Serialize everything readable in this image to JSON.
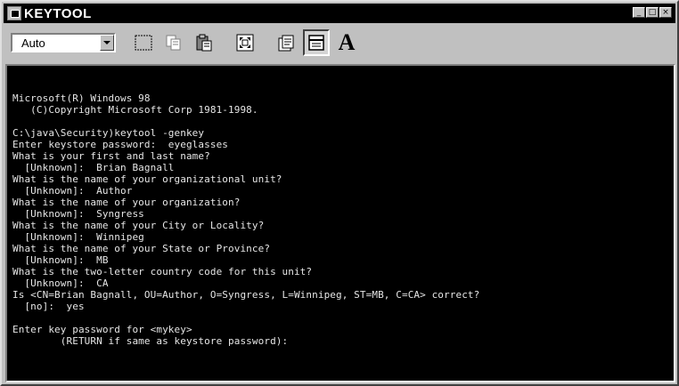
{
  "window": {
    "title": "KEYTOOL",
    "minimize_glyph": "_",
    "maximize_glyph": "□",
    "close_glyph": "×"
  },
  "toolbar": {
    "font_size_value": "Auto",
    "icons": [
      "mark-icon",
      "copy-icon",
      "paste-icon",
      "full-screen-icon",
      "properties-icon",
      "background-icon",
      "font-icon"
    ],
    "font_button_label": "A"
  },
  "console": {
    "lines": [
      "Microsoft(R) Windows 98",
      "   (C)Copyright Microsoft Corp 1981-1998.",
      "",
      "C:\\java\\Security)keytool -genkey",
      "Enter keystore password:  eyeglasses",
      "What is your first and last name?",
      "  [Unknown]:  Brian Bagnall",
      "What is the name of your organizational unit?",
      "  [Unknown]:  Author",
      "What is the name of your organization?",
      "  [Unknown]:  Syngress",
      "What is the name of your City or Locality?",
      "  [Unknown]:  Winnipeg",
      "What is the name of your State or Province?",
      "  [Unknown]:  MB",
      "What is the two-letter country code for this unit?",
      "  [Unknown]:  CA",
      "Is <CN=Brian Bagnall, OU=Author, O=Syngress, L=Winnipeg, ST=MB, C=CA> correct?",
      "  [no]:  yes",
      "",
      "Enter key password for <mykey>",
      "        (RETURN if same as keystore password):"
    ]
  }
}
